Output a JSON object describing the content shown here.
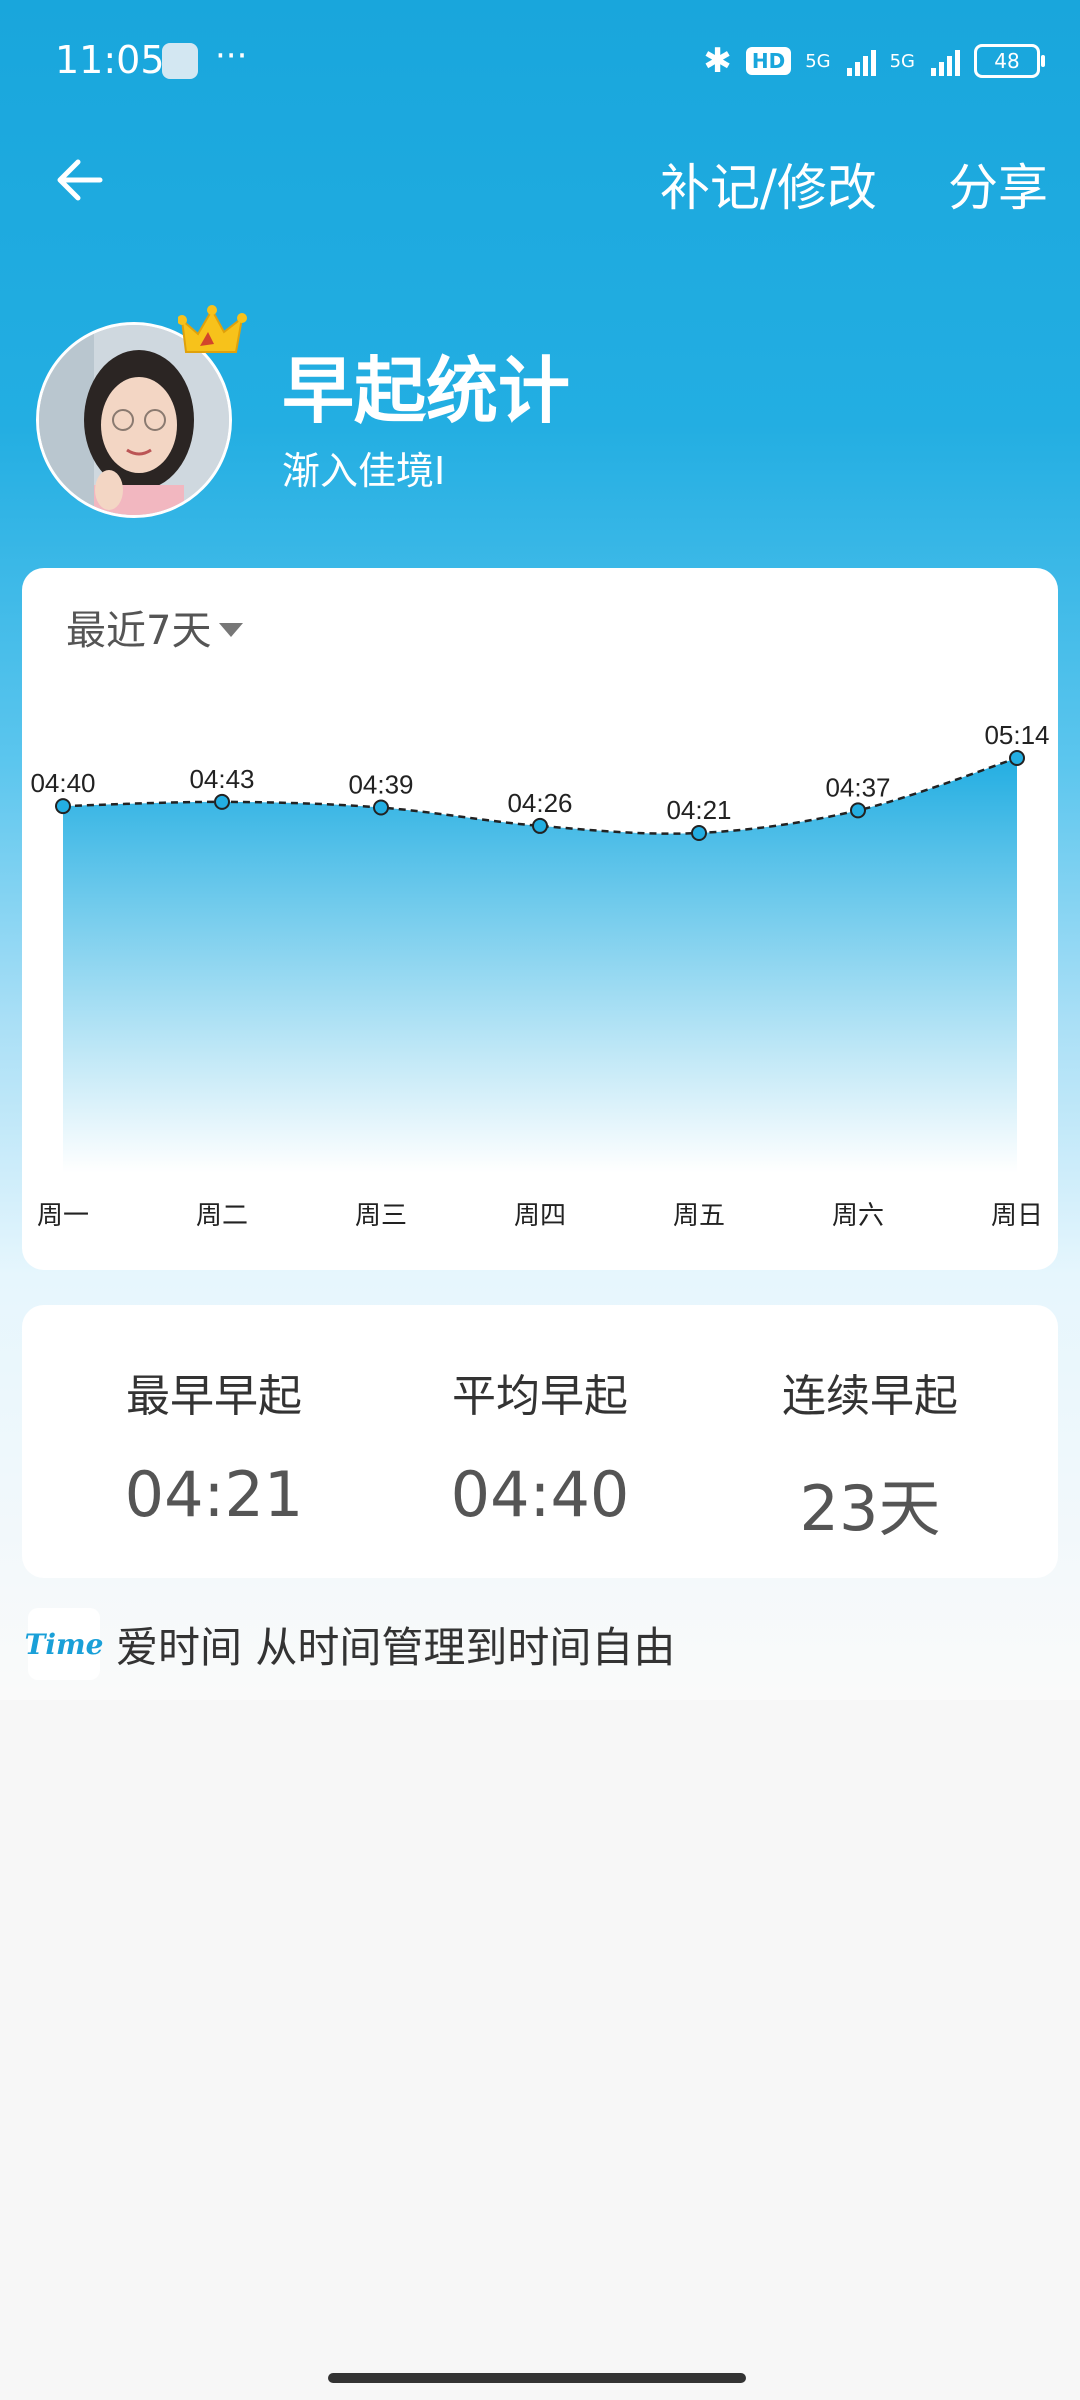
{
  "status_bar": {
    "time": "11:05",
    "dots": "···",
    "hd": "HD",
    "signal1_label": "5G",
    "signal2_label": "5G",
    "battery": "48"
  },
  "app_bar": {
    "back_icon": "arrow-left-icon",
    "edit_label": "补记/修改",
    "share_label": "分享"
  },
  "profile": {
    "title": "早起统计",
    "subtitle": "渐入佳境I"
  },
  "chart_card": {
    "period_label": "最近7天"
  },
  "chart_data": {
    "type": "area",
    "categories": [
      "周一",
      "周二",
      "周三",
      "周四",
      "周五",
      "周六",
      "周日"
    ],
    "series": [
      {
        "values": [
          "04:40",
          "04:43",
          "04:39",
          "04:26",
          "04:21",
          "04:37",
          "05:14"
        ]
      }
    ],
    "grid": false,
    "line_style": "dashed",
    "colors": {
      "fill_top": "#23aee2",
      "fill_bottom": "#ffffff",
      "point": "#23aee2",
      "line": "#222222"
    }
  },
  "stats": [
    {
      "label": "最早早起",
      "value": "04:21"
    },
    {
      "label": "平均早起",
      "value": "04:40"
    },
    {
      "label": "连续早起",
      "value": "23天"
    }
  ],
  "brand": {
    "logo_text": "Time",
    "text": "爱时间 从时间管理到时间自由"
  },
  "colors": {
    "accent": "#19a6dc",
    "card": "#ffffff"
  }
}
